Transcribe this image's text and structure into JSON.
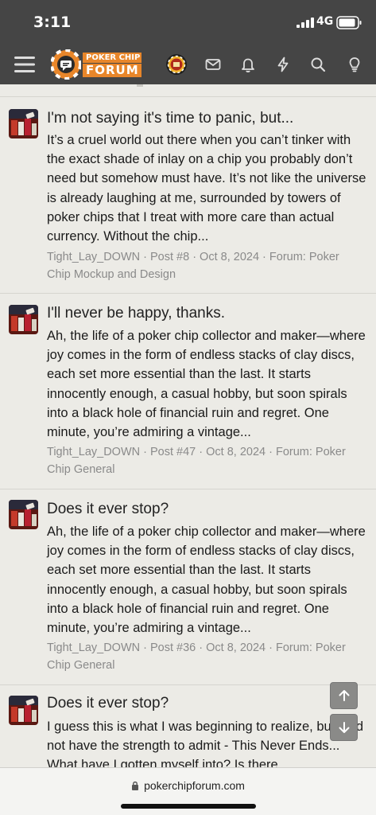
{
  "status_bar": {
    "time": "3:11",
    "network": "4G"
  },
  "header": {
    "logo_line1": "POKER CHIP",
    "logo_line2": "FORUM",
    "icons": [
      "menu-icon",
      "avatar",
      "mail-icon",
      "bell-icon",
      "lightning-icon",
      "search-icon",
      "lightbulb-icon"
    ]
  },
  "posts": [
    {
      "title": "I'm not saying it's time to panic, but...",
      "body": "It’s a cruel world out there when you can’t tinker with the exact shade of inlay on a chip you probably don’t need but somehow must have. It’s not like the universe is already laughing at me, surrounded by towers of poker chips that I treat with more care than actual currency. Without the chip...",
      "meta": "Tight_Lay_DOWN · Post #8 · Oct 8, 2024 · Forum: Poker Chip Mockup and Design"
    },
    {
      "title": "I'll never be happy, thanks.",
      "body": "Ah, the life of a poker chip collector and maker—where joy comes in the form of endless stacks of clay discs, each set more essential than the last. It starts innocently enough, a casual hobby, but soon spirals into a black hole of financial ruin and regret. One minute, you’re admiring a vintage...",
      "meta": "Tight_Lay_DOWN · Post #47 · Oct 8, 2024 · Forum: Poker Chip General"
    },
    {
      "title": "Does it ever stop?",
      "body": "Ah, the life of a poker chip collector and maker—where joy comes in the form of endless stacks of clay discs, each set more essential than the last. It starts innocently enough, a casual hobby, but soon spirals into a black hole of financial ruin and regret. One minute, you’re admiring a vintage...",
      "meta": "Tight_Lay_DOWN · Post #36 · Oct 8, 2024 · Forum: Poker Chip General"
    },
    {
      "title": "Does it ever stop?",
      "body": "I guess this is what I was beginning to realize, but I did not have the strength to admit - This Never Ends... What have I gotten myself into? Is there",
      "meta": ""
    }
  ],
  "browser": {
    "url": "pokerchipforum.com"
  },
  "colors": {
    "header_bg": "#454545",
    "page_bg": "#ecebe6",
    "logo_orange": "#e8862a",
    "meta_gray": "#8a8a8a"
  }
}
